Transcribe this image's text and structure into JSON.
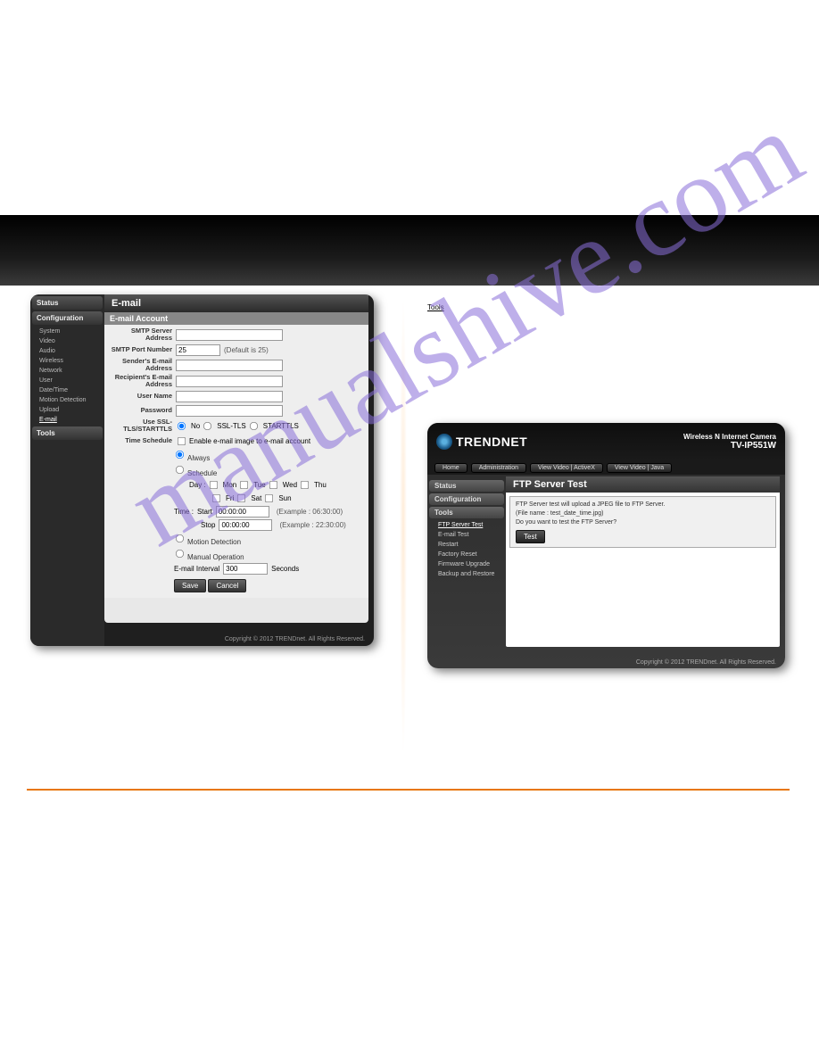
{
  "left": {
    "sidebar": {
      "status": "Status",
      "config": "Configuration",
      "items": [
        "System",
        "Video",
        "Audio",
        "Wireless",
        "Network",
        "User",
        "Date/Time",
        "Motion Detection",
        "Upload",
        "E-mail"
      ],
      "tools": "Tools"
    },
    "title": "E-mail",
    "section": "E-mail Account",
    "labels": {
      "smtp_server": "SMTP Server Address",
      "smtp_port": "SMTP Port Number",
      "port_default": "(Default is 25)",
      "port_value": "25",
      "sender": "Sender's E-mail Address",
      "recipient": "Recipient's E-mail Address",
      "username": "User Name",
      "password": "Password",
      "ssl": "Use SSL-TLS/STARTTLS",
      "ssl_no": "No",
      "ssl_ssltls": "SSL-TLS",
      "ssl_starttls": "STARTTLS",
      "schedule": "Time Schedule",
      "enable": "Enable e-mail image to e-mail account",
      "always": "Always",
      "sched": "Schedule",
      "day": "Day :",
      "mon": "Mon",
      "tue": "Tue",
      "wed": "Wed",
      "thu": "Thu",
      "fri": "Fri",
      "sat": "Sat",
      "sun": "Sun",
      "time": "Time :",
      "start": "Start",
      "stop": "Stop",
      "start_val": "00:00:00",
      "stop_val": "00:00:00",
      "ex1": "(Example : 06:30:00)",
      "ex2": "(Example : 22:30:00)",
      "motion": "Motion Detection",
      "manual": "Manual Operation",
      "interval_label": "E-mail Interval",
      "interval_val": "300",
      "seconds": "Seconds",
      "save": "Save",
      "cancel": "Cancel"
    },
    "copyright": "Copyright © 2012 TRENDnet. All Rights Reserved."
  },
  "right": {
    "brand": "TRENDNET",
    "model_line1": "Wireless N Internet Camera",
    "model_line2": "TV-IP551W",
    "nav": [
      "Home",
      "Administration",
      "View Video | ActiveX",
      "View Video | Java"
    ],
    "side": {
      "status": "Status",
      "config": "Configuration",
      "tools": "Tools",
      "items": [
        "FTP Server Test",
        "E-mail Test",
        "Restart",
        "Factory Reset",
        "Firmware Upgrade",
        "Backup and Restore"
      ]
    },
    "title": "FTP Server Test",
    "box_line1": "FTP Server test will upload a JPEG file to FTP Server.",
    "box_line2": "(File name : test_date_time.jpg)",
    "box_line3": "Do you want to test the FTP Server?",
    "test": "Test",
    "copyright": "Copyright © 2012 TRENDnet. All Rights Reserved."
  },
  "misc": {
    "watermark": "manualshive.com",
    "heading": "Tools"
  }
}
